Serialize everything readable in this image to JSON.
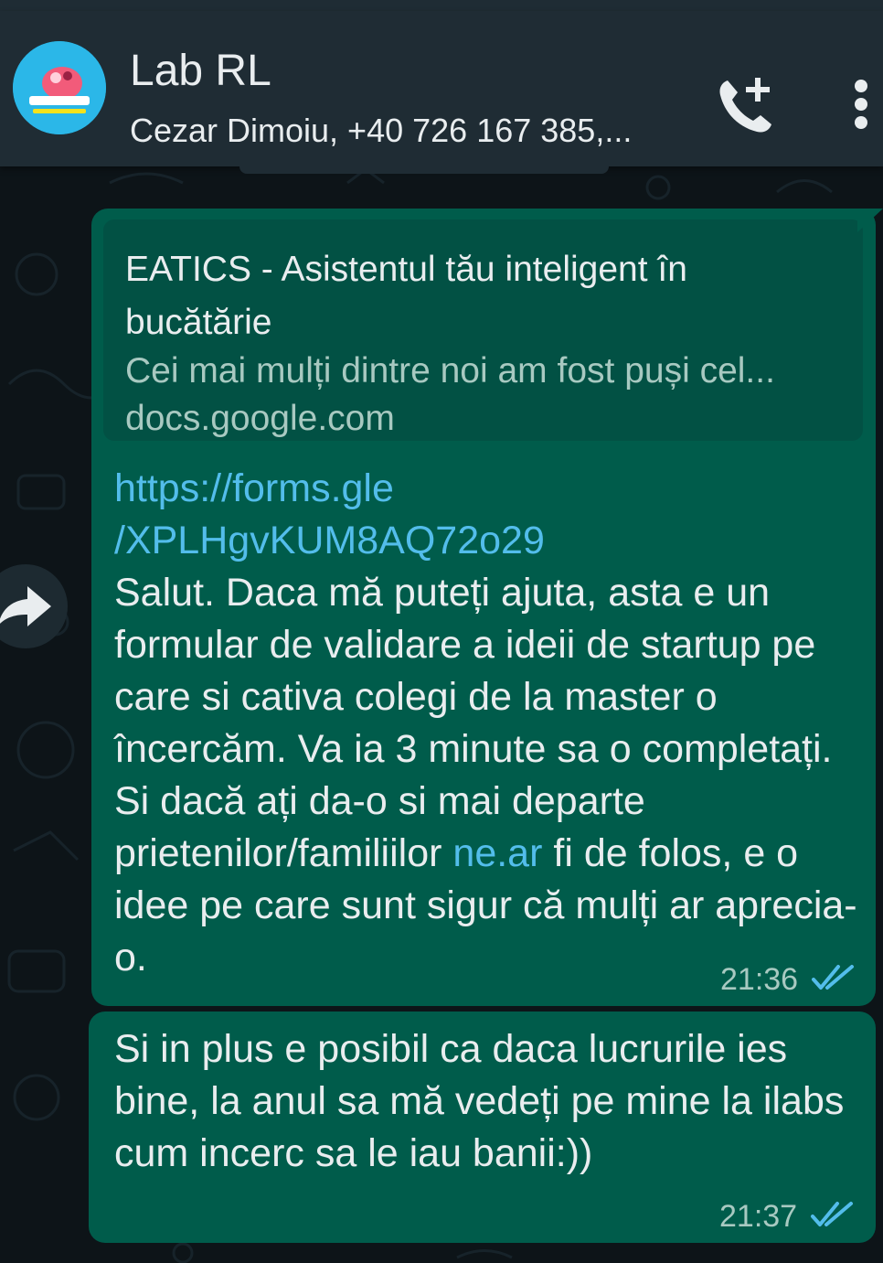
{
  "header": {
    "title": "Lab RL",
    "subtitle": "Cezar Dimoiu, +40 726 167 385,...",
    "call_icon": "add-call-icon",
    "menu_icon": "more-vert-icon"
  },
  "messages": [
    {
      "preview": {
        "title": "EATICS - Asistentul tău inteligent în bucătărie",
        "description": "Cei mai mulți dintre noi am fost puși cel...",
        "domain": "docs.google.com"
      },
      "link_line1": "https://forms.gle",
      "link_line2": "/XPLHgvKUM8AQ72o29",
      "text_part1": "Salut. Daca mă puteți ajuta, asta e un formular de validare a ideii de startup pe care si cativa colegi de la master o încercăm. Va ia 3 minute sa o completați. Si dacă ați da-o si mai departe prietenilor/familiilor ",
      "inline_link": "ne.ar",
      "text_part2": " fi de folos, e o idee pe care sunt sigur că mulți ar aprecia-o.",
      "time": "21:36",
      "status": "read"
    },
    {
      "text": "Si in plus e posibil ca daca lucrurile ies bine, la anul sa mă vedeți pe mine la ilabs cum incerc sa le iau banii:))",
      "time": "21:37",
      "status": "read"
    }
  ],
  "icons": {
    "forward": "forward-icon",
    "read_receipt": "double-check-icon"
  },
  "colors": {
    "header_bg": "#1f2c34",
    "chat_bg": "#0d1418",
    "outgoing_bubble": "#005c4b",
    "link": "#53bdeb",
    "read_tick": "#53bdeb"
  }
}
